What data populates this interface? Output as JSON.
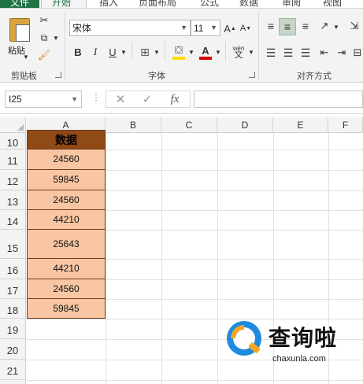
{
  "tabs": [
    "文件",
    "开始",
    "插入",
    "页面布局",
    "公式",
    "数据",
    "审阅",
    "视图"
  ],
  "ribbon": {
    "clipboard": {
      "paste_label": "粘贴",
      "group_label": "剪贴板"
    },
    "font": {
      "font_name": "宋体",
      "font_size": "11",
      "group_label": "字体",
      "bold": "B",
      "italic": "I",
      "underline": "U",
      "grow": "A",
      "shrink": "A",
      "wen": "wén"
    },
    "alignment": {
      "group_label": "对齐方式"
    }
  },
  "formula_bar": {
    "name_box": "I25",
    "cancel": "✕",
    "enter": "✓",
    "fx": "fx",
    "value": ""
  },
  "columns": [
    "A",
    "B",
    "C",
    "D",
    "E",
    "F"
  ],
  "rows": [
    "10",
    "11",
    "12",
    "13",
    "14",
    "15",
    "16",
    "17",
    "18",
    "19",
    "20",
    "21"
  ],
  "cells": {
    "A10": "数据",
    "A11": "24560",
    "A12": "59845",
    "A13": "24560",
    "A14": "44210",
    "A15": "25643",
    "A16": "44210",
    "A17": "24560",
    "A18": "59845"
  },
  "colors": {
    "header_fill": "#8f4a16",
    "data_fill": "#f8c6a2",
    "accent": "#217346",
    "fill_color_bar": "#ffe000",
    "font_color_bar": "#e00000"
  },
  "watermark": {
    "text": "查询啦",
    "url": "chaxunla.com"
  }
}
